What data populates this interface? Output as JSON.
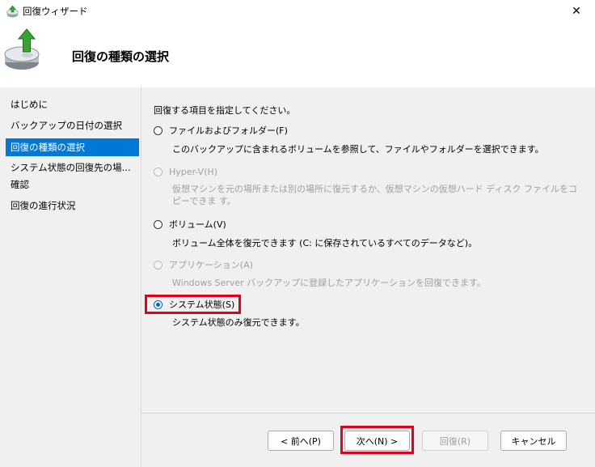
{
  "window": {
    "title": "回復ウィザード",
    "close_glyph": "✕"
  },
  "header": {
    "title": "回復の種類の選択"
  },
  "sidebar": {
    "items": [
      {
        "label": "はじめに"
      },
      {
        "label": "バックアップの日付の選択"
      },
      {
        "label": "回復の種類の選択"
      },
      {
        "label": "システム状態の回復先の場..."
      },
      {
        "label": "確認"
      },
      {
        "label": "回復の進行状況"
      }
    ]
  },
  "main": {
    "instruction": "回復する項目を指定してください。",
    "options": [
      {
        "label": "ファイルおよびフォルダー(F)",
        "description": "このバックアップに含まれるボリュームを参照して、ファイルやフォルダーを選択できます。"
      },
      {
        "label": "Hyper-V(H)",
        "description": "仮想マシンを元の場所または別の場所に復元するか、仮想マシンの仮想ハード ディスク ファイルをコピーできま す。"
      },
      {
        "label": "ボリューム(V)",
        "description": "ボリューム全体を復元できます (C: に保存されているすべてのデータなど)。"
      },
      {
        "label": "アプリケーション(A)",
        "description": "Windows Server バックアップに登録したアプリケーションを回復できます。"
      },
      {
        "label": "システム状態(S)",
        "description": "システム状態のみ復元できます。"
      }
    ]
  },
  "footer": {
    "prev_label": "< 前へ(P)",
    "next_label": "次へ(N) >",
    "recover_label": "回復(R)",
    "cancel_label": "キャンセル"
  },
  "colors": {
    "accent": "#0078d7",
    "highlight": "#e3001b",
    "radio_checked": "#0067c0"
  }
}
